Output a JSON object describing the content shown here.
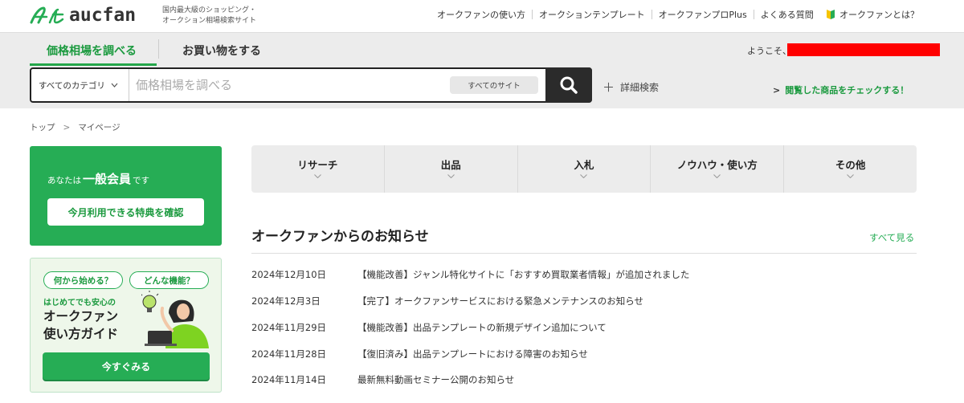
{
  "header": {
    "logo_text": "aucfan",
    "tagline_line1": "国内最大級のショッピング・",
    "tagline_line2": "オークション相場検索サイト",
    "nav": [
      "オークファンの使い方",
      "オークションテンプレート",
      "オークファンプロPlus",
      "よくある質問"
    ],
    "about_label": "オークファンとは？"
  },
  "tabs": {
    "price_research": "価格相場を調べる",
    "shopping": "お買い物をする"
  },
  "welcome_label": "ようこそ、",
  "search": {
    "category": "すべてのカテゴリ",
    "placeholder": "価格相場を調べる",
    "site_filter": "すべてのサイト",
    "advanced": "詳細検索",
    "viewed_items": "閲覧した商品をチェックする！"
  },
  "breadcrumb": [
    "トップ",
    "マイページ"
  ],
  "member": {
    "prefix": "あなたは",
    "rank": "一般会員",
    "suffix": "です",
    "benefit_button": "今月利用できる特典を確認"
  },
  "guide": {
    "pill1": "何から始める？",
    "pill2": "どんな機能？",
    "subtitle": "はじめてでも安心の",
    "title_line1": "オークファン",
    "title_line2": "使い方ガイド",
    "button": "今すぐみる"
  },
  "categories": [
    "リサーチ",
    "出品",
    "入札",
    "ノウハウ・使い方",
    "その他"
  ],
  "news": {
    "title": "オークファンからのお知らせ",
    "see_all": "すべて見る",
    "items": [
      {
        "date": "2024年12月10日",
        "text": "【機能改善】ジャンル特化サイトに「おすすめ買取業者情報」が追加されました"
      },
      {
        "date": "2024年12月3日",
        "text": "【完了】オークファンサービスにおける緊急メンテナンスのお知らせ"
      },
      {
        "date": "2024年11月29日",
        "text": "【機能改善】出品テンプレートの新規デザイン追加について"
      },
      {
        "date": "2024年11月28日",
        "text": "【復旧済み】出品テンプレートにおける障害のお知らせ"
      },
      {
        "date": "2024年11月14日",
        "text": "最新無料動画セミナー公開のお知らせ"
      }
    ]
  },
  "colors": {
    "brand_green": "#26ad55",
    "header_gray": "#ececec",
    "search_button": "#2b2b2b",
    "redaction": "#ff0000"
  }
}
